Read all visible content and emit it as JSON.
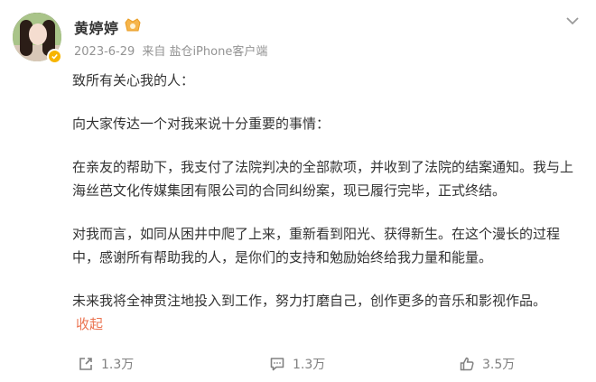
{
  "author": {
    "name": "黄婷婷",
    "avatar_icon": "user-avatar",
    "verified_icon": "verified-badge-icon",
    "member_icon": "member-badge-icon"
  },
  "meta": {
    "date": "2023-6-29",
    "source_prefix": "来自",
    "source": "盐仓iPhone客户端"
  },
  "content": {
    "paragraphs": [
      "致所有关心我的人：",
      "向大家传达一个对我来说十分重要的事情：",
      "在亲友的帮助下，我支付了法院判决的全部款项，并收到了法院的结案通知。我与上海丝芭文化传媒集团有限公司的合同纠纷案，现已履行完毕，正式终结。",
      "对我而言，如同从困井中爬了上来，重新看到阳光、获得新生。在这个漫长的过程中，感谢所有帮助我的人，是你们的支持和勉励始终给我力量和能量。",
      "未来我将全神贯注地投入到工作，努力打磨自己，创作更多的音乐和影视作品。"
    ],
    "collapse_label": "收起"
  },
  "actions": {
    "share": {
      "icon": "share-icon",
      "count": "1.3万"
    },
    "comment": {
      "icon": "comment-icon",
      "count": "1.3万"
    },
    "like": {
      "icon": "like-icon",
      "count": "3.5万"
    }
  },
  "colors": {
    "link": "#eb7350",
    "meta": "#939393",
    "text": "#333333",
    "badge": "#f7b500"
  }
}
